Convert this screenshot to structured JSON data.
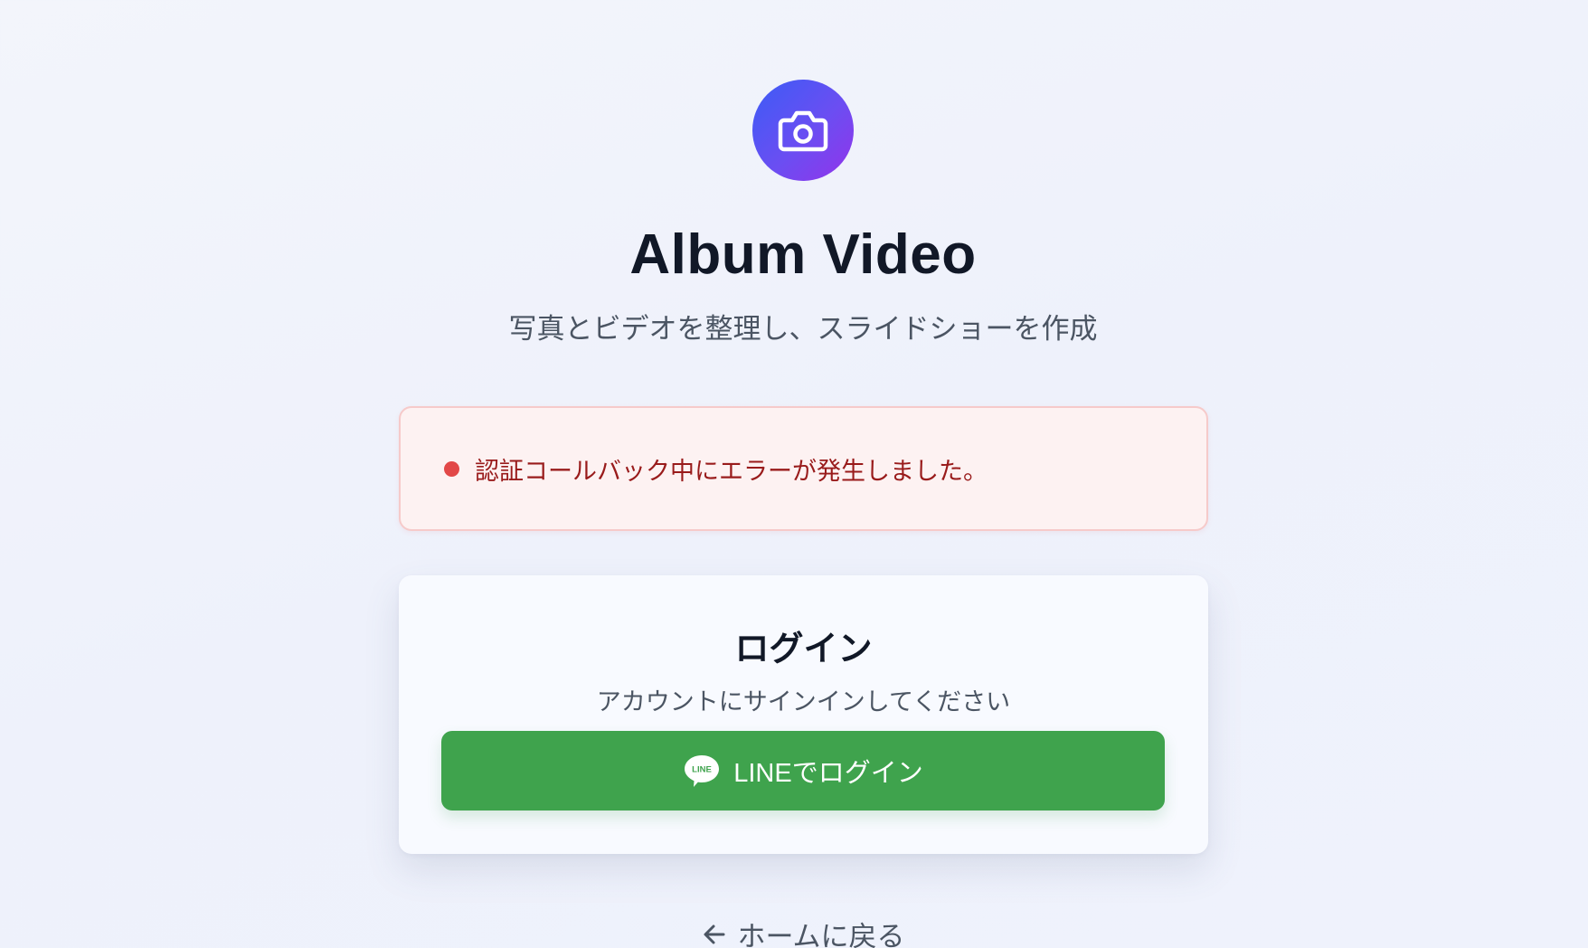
{
  "app": {
    "title": "Album Video",
    "subtitle": "写真とビデオを整理し、スライドショーを作成",
    "logo_icon": "camera-icon",
    "gradient_start": "#3b5cf6",
    "gradient_end": "#9333ea"
  },
  "error": {
    "message": "認証コールバック中にエラーが発生しました。",
    "dot_color": "#e24848",
    "text_color": "#991b1b",
    "background": "#fdf2f2"
  },
  "login": {
    "title": "ログイン",
    "description": "アカウントにサインインしてください",
    "line_button_label": "LINEでログイン",
    "line_icon_text": "LINE",
    "line_button_color": "#3fa34d"
  },
  "footer": {
    "back_link_label": "ホームに戻る",
    "back_icon": "arrow-left-icon"
  }
}
